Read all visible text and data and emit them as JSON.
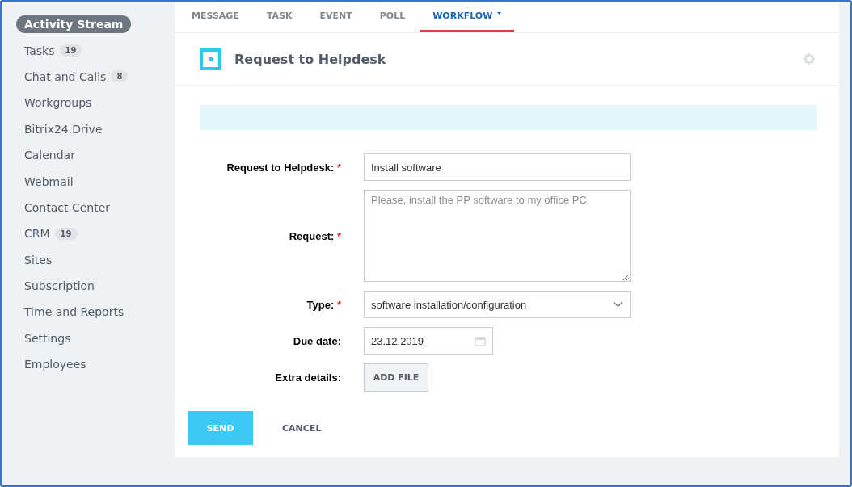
{
  "sidebar": {
    "items": [
      {
        "label": "Activity Stream",
        "selected": true
      },
      {
        "label": "Tasks",
        "badge": "19",
        "selected": false
      },
      {
        "label": "Chat and Calls",
        "badge": "8",
        "selected": false
      },
      {
        "label": "Workgroups",
        "selected": false
      },
      {
        "label": "Bitrix24.Drive",
        "selected": false
      },
      {
        "label": "Calendar",
        "selected": false
      },
      {
        "label": "Webmail",
        "selected": false
      },
      {
        "label": "Contact Center",
        "selected": false
      },
      {
        "label": "CRM",
        "badge": "19",
        "selected": false
      },
      {
        "label": "Sites",
        "selected": false
      },
      {
        "label": "Subscription",
        "selected": false
      },
      {
        "label": "Time and Reports",
        "selected": false
      },
      {
        "label": "Settings",
        "selected": false
      },
      {
        "label": "Employees",
        "selected": false
      }
    ]
  },
  "tabs": [
    {
      "label": "MESSAGE",
      "selected": false
    },
    {
      "label": "TASK",
      "selected": false
    },
    {
      "label": "EVENT",
      "selected": false
    },
    {
      "label": "POLL",
      "selected": false
    },
    {
      "label": "WORKFLOW",
      "selected": true,
      "dropdown": true
    }
  ],
  "form": {
    "title": "Request to Helpdesk",
    "fields": [
      {
        "kind": "text",
        "label": "Request to Helpdesk:",
        "required_mark": "*",
        "value": "Install software"
      },
      {
        "kind": "textarea",
        "label": "Request:",
        "required_mark": "*",
        "placeholder": "Please, install the PP software to my office PC."
      },
      {
        "kind": "select",
        "label": "Type:",
        "required_mark": "*",
        "value": "software installation/configuration"
      },
      {
        "kind": "date",
        "label": "Due date:",
        "value": "23.12.2019"
      },
      {
        "kind": "file",
        "label": "Extra details:",
        "button": "ADD FILE"
      }
    ]
  },
  "buttons": {
    "send": "SEND",
    "cancel": "CANCEL"
  }
}
